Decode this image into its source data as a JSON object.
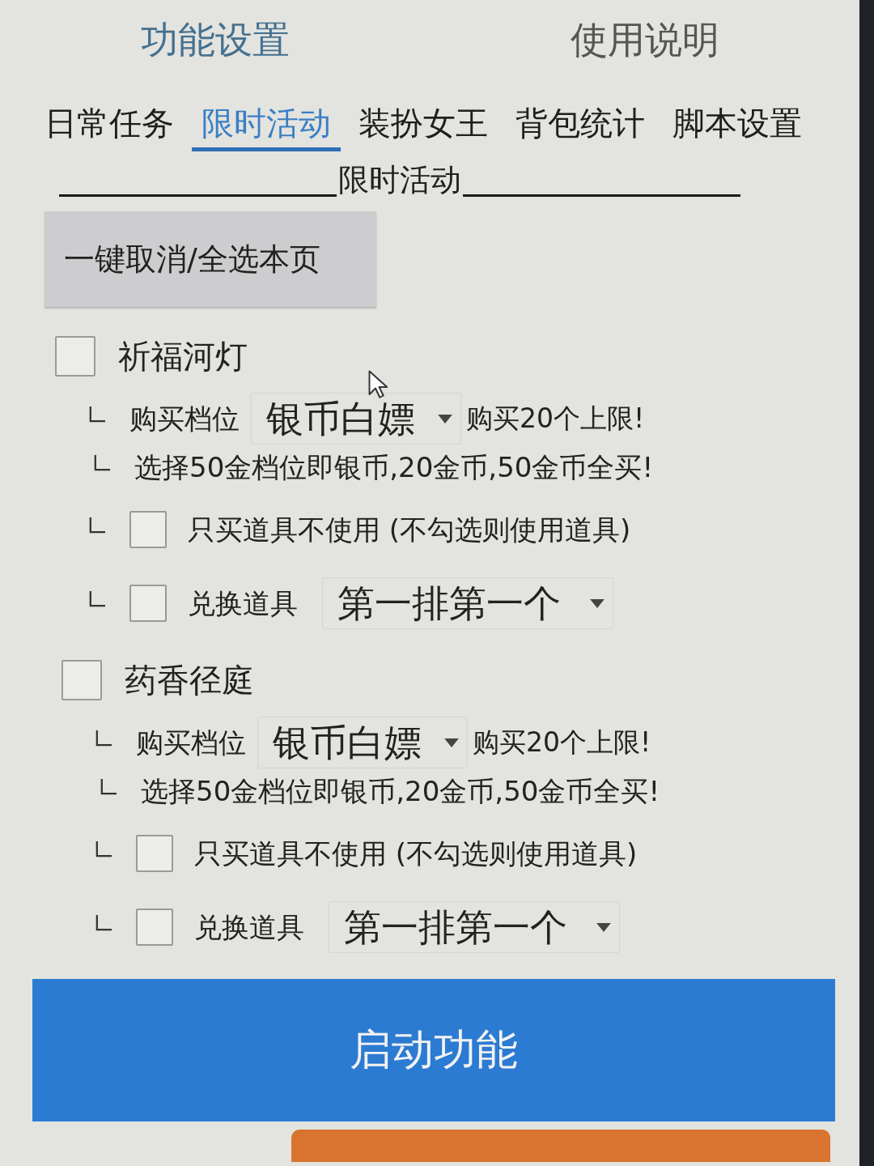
{
  "top_tabs": [
    {
      "label": "功能设置",
      "selected": true
    },
    {
      "label": "使用说明",
      "selected": false
    }
  ],
  "sub_tabs": [
    {
      "label": "日常任务",
      "selected": false
    },
    {
      "label": "限时活动",
      "selected": true
    },
    {
      "label": "装扮女王",
      "selected": false
    },
    {
      "label": "背包统计",
      "selected": false
    },
    {
      "label": "脚本设置",
      "selected": false
    }
  ],
  "section": {
    "title": "限时活动"
  },
  "toggle_all_button": {
    "label": "一键取消/全选本页"
  },
  "events": [
    {
      "name": "祈福河灯",
      "checked": false,
      "options": [
        {
          "kind": "select",
          "label": "购买档位",
          "value": "银币白嫖",
          "note": "购买20个上限!"
        },
        {
          "kind": "note",
          "text": "选择50金档位即银币,20金币,50金币全买!"
        },
        {
          "kind": "checkbox",
          "label": "只买道具不使用 (不勾选则使用道具)",
          "checked": false
        },
        {
          "kind": "checkbox_select",
          "label": "兑换道具",
          "checked": false,
          "value": "第一排第一个"
        }
      ]
    },
    {
      "name": "药香径庭",
      "checked": false,
      "options": [
        {
          "kind": "select",
          "label": "购买档位",
          "value": "银币白嫖",
          "note": "购买20个上限!"
        },
        {
          "kind": "note",
          "text": "选择50金档位即银币,20金币,50金币全买!"
        },
        {
          "kind": "checkbox",
          "label": "只买道具不使用 (不勾选则使用道具)",
          "checked": false
        },
        {
          "kind": "checkbox_select",
          "label": "兑换道具",
          "checked": false,
          "value": "第一排第一个"
        }
      ]
    }
  ],
  "start_button": {
    "label": "启动功能"
  }
}
